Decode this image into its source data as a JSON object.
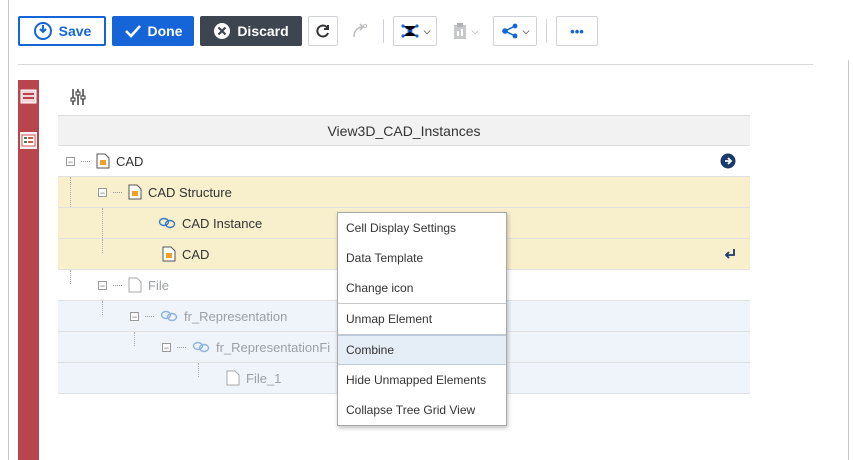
{
  "toolbar": {
    "save_label": "Save",
    "done_label": "Done",
    "discard_label": "Discard",
    "more_label": "•••"
  },
  "grid": {
    "title": "View3D_CAD_Instances",
    "rows": [
      {
        "label": "CAD"
      },
      {
        "label": "CAD Structure"
      },
      {
        "label": "CAD Instance"
      },
      {
        "label": "CAD"
      },
      {
        "label": "File"
      },
      {
        "label": "fr_Representation"
      },
      {
        "label": "fr_RepresentationFi"
      },
      {
        "label": "File_1"
      }
    ]
  },
  "context_menu": {
    "items": [
      "Cell Display Settings",
      "Data Template",
      "Change icon",
      "Unmap Element",
      "Combine",
      "Hide Unmapped Elements",
      "Collapse Tree Grid View"
    ]
  },
  "colors": {
    "primary": "#1565d8",
    "dark_button": "#3d4650",
    "rail": "#b8454c",
    "highlight_row": "#f8efcc"
  }
}
